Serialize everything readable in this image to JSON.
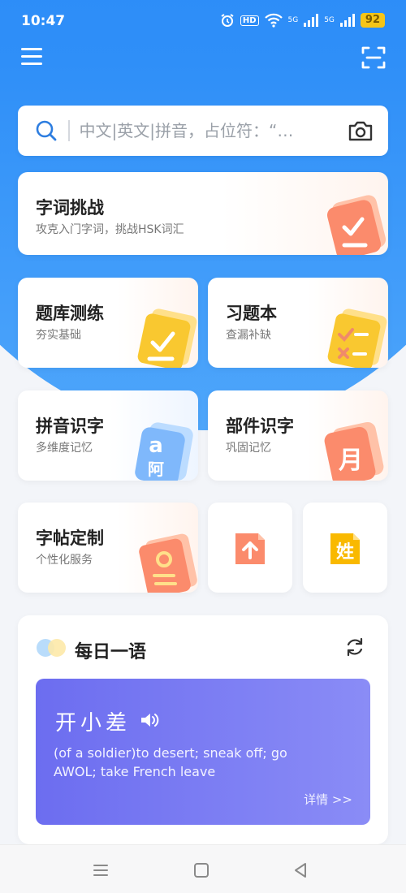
{
  "status_bar": {
    "time": "10:47",
    "hd": "HD",
    "net1": "5G",
    "net2": "5G",
    "battery": "92"
  },
  "header": {
    "menu_icon": "hamburger-menu-icon",
    "scan_icon": "scan-icon"
  },
  "search": {
    "placeholder": "中文|英文|拼音，占位符：“…",
    "icon": "search-icon",
    "camera_icon": "camera-icon"
  },
  "features": {
    "word_challenge": {
      "title": "字词挑战",
      "subtitle": "攻克入门字词，挑战HSK词汇"
    },
    "quiz_bank": {
      "title": "题库测练",
      "subtitle": "夯实基础"
    },
    "exercise_book": {
      "title": "习题本",
      "subtitle": "查漏补缺"
    },
    "pinyin": {
      "title": "拼音识字",
      "subtitle": "多维度记忆"
    },
    "radical": {
      "title": "部件识字",
      "subtitle": "巩固记忆"
    },
    "copybook": {
      "title": "字帖定制",
      "subtitle": "个性化服务"
    }
  },
  "illustrations": {
    "pinyin_top": "a",
    "pinyin_bottom": "阿",
    "radical": "月",
    "surname": "姓"
  },
  "daily": {
    "title": "每日一语",
    "word": "开小差",
    "definition": "(of a soldier)to desert; sneak off; go AWOL; take French leave",
    "more": "详情 >>"
  },
  "colors": {
    "primary": "#1f80f5",
    "word_card": "#6c6df0",
    "battery": "#f5c518"
  }
}
